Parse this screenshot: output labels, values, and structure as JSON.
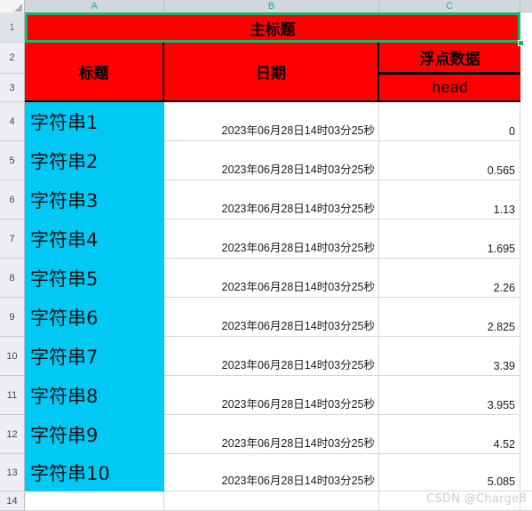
{
  "app": {
    "type": "spreadsheet",
    "select_all_icon": "select-all-triangle-icon"
  },
  "colors": {
    "header_fill": "#ff0000",
    "column_a_fill": "#00c9f5",
    "selection_border": "#1ab56c",
    "grid_line": "#d2d6db",
    "gutter_fill": "#eceef1",
    "watermark": "#c9ccd1"
  },
  "column_headers": [
    {
      "label": "A"
    },
    {
      "label": "B"
    },
    {
      "label": "C"
    }
  ],
  "row_headers": [
    {
      "label": "1"
    },
    {
      "label": "2"
    },
    {
      "label": "3"
    },
    {
      "label": "4"
    },
    {
      "label": "5"
    },
    {
      "label": "6"
    },
    {
      "label": "7"
    },
    {
      "label": "8"
    },
    {
      "label": "9"
    },
    {
      "label": "10"
    },
    {
      "label": "11"
    },
    {
      "label": "12"
    },
    {
      "label": "13"
    },
    {
      "label": "14"
    }
  ],
  "title_row": {
    "text": "主标题",
    "merge": "A1:C1",
    "selected": true
  },
  "table_headers": {
    "col_a": {
      "text": "标题",
      "merge": "A2:A3"
    },
    "col_b": {
      "text": "日期",
      "merge": "B2:B3"
    },
    "col_c_top": {
      "text": "浮点数据",
      "cell": "C2"
    },
    "col_c_sub": {
      "text": "head",
      "cell": "C3"
    }
  },
  "rows": [
    {
      "row": "4",
      "a": "字符串1",
      "b": "2023年06月28日14时03分25秒",
      "c": "0"
    },
    {
      "row": "5",
      "a": "字符串2",
      "b": "2023年06月28日14时03分25秒",
      "c": "0.565"
    },
    {
      "row": "6",
      "a": "字符串3",
      "b": "2023年06月28日14时03分25秒",
      "c": "1.13"
    },
    {
      "row": "7",
      "a": "字符串4",
      "b": "2023年06月28日14时03分25秒",
      "c": "1.695"
    },
    {
      "row": "8",
      "a": "字符串5",
      "b": "2023年06月28日14时03分25秒",
      "c": "2.26"
    },
    {
      "row": "9",
      "a": "字符串6",
      "b": "2023年06月28日14时03分25秒",
      "c": "2.825"
    },
    {
      "row": "10",
      "a": "字符串7",
      "b": "2023年06月28日14时03分25秒",
      "c": "3.39"
    },
    {
      "row": "11",
      "a": "字符串8",
      "b": "2023年06月28日14时03分25秒",
      "c": "3.955"
    },
    {
      "row": "12",
      "a": "字符串9",
      "b": "2023年06月28日14时03分25秒",
      "c": "4.52"
    },
    {
      "row": "13",
      "a": "字符串10",
      "b": "2023年06月28日14时03分25秒",
      "c": "5.085"
    }
  ],
  "watermark": {
    "text": "CSDN @Charge8"
  }
}
